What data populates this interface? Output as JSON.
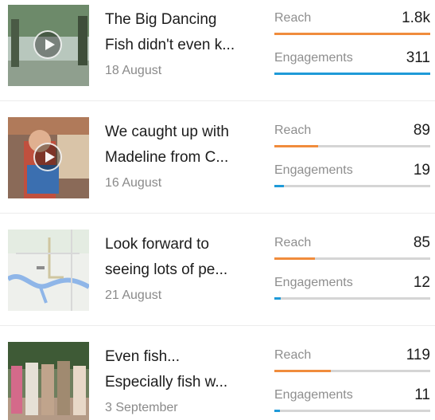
{
  "colors": {
    "reach": "#f08c3c",
    "engagements": "#1f9ad8"
  },
  "posts": [
    {
      "title_line1": "The Big Dancing",
      "title_line2": "Fish didn't even k...",
      "date": "18 August",
      "has_video": true,
      "thumbnail": "video-thumbnail",
      "reach_label": "Reach",
      "reach_value": "1.8k",
      "reach_fill": 1.0,
      "engagements_label": "Engagements",
      "engagements_value": "311",
      "engagements_fill": 1.0
    },
    {
      "title_line1": "We caught up with",
      "title_line2": "Madeline from C...",
      "date": "16 August",
      "has_video": true,
      "thumbnail": "video-thumbnail",
      "reach_label": "Reach",
      "reach_value": "89",
      "reach_fill": 0.28,
      "engagements_label": "Engagements",
      "engagements_value": "19",
      "engagements_fill": 0.06
    },
    {
      "title_line1": "Look forward to",
      "title_line2": "seeing lots of pe...",
      "date": "21 August",
      "has_video": false,
      "thumbnail": "map-thumbnail",
      "reach_label": "Reach",
      "reach_value": "85",
      "reach_fill": 0.26,
      "engagements_label": "Engagements",
      "engagements_value": "12",
      "engagements_fill": 0.04
    },
    {
      "title_line1": "Even fish...",
      "title_line2": "Especially fish w...",
      "date": "3 September",
      "has_video": false,
      "thumbnail": "photo-thumbnail",
      "reach_label": "Reach",
      "reach_value": "119",
      "reach_fill": 0.36,
      "engagements_label": "Engagements",
      "engagements_value": "11",
      "engagements_fill": 0.035
    }
  ]
}
